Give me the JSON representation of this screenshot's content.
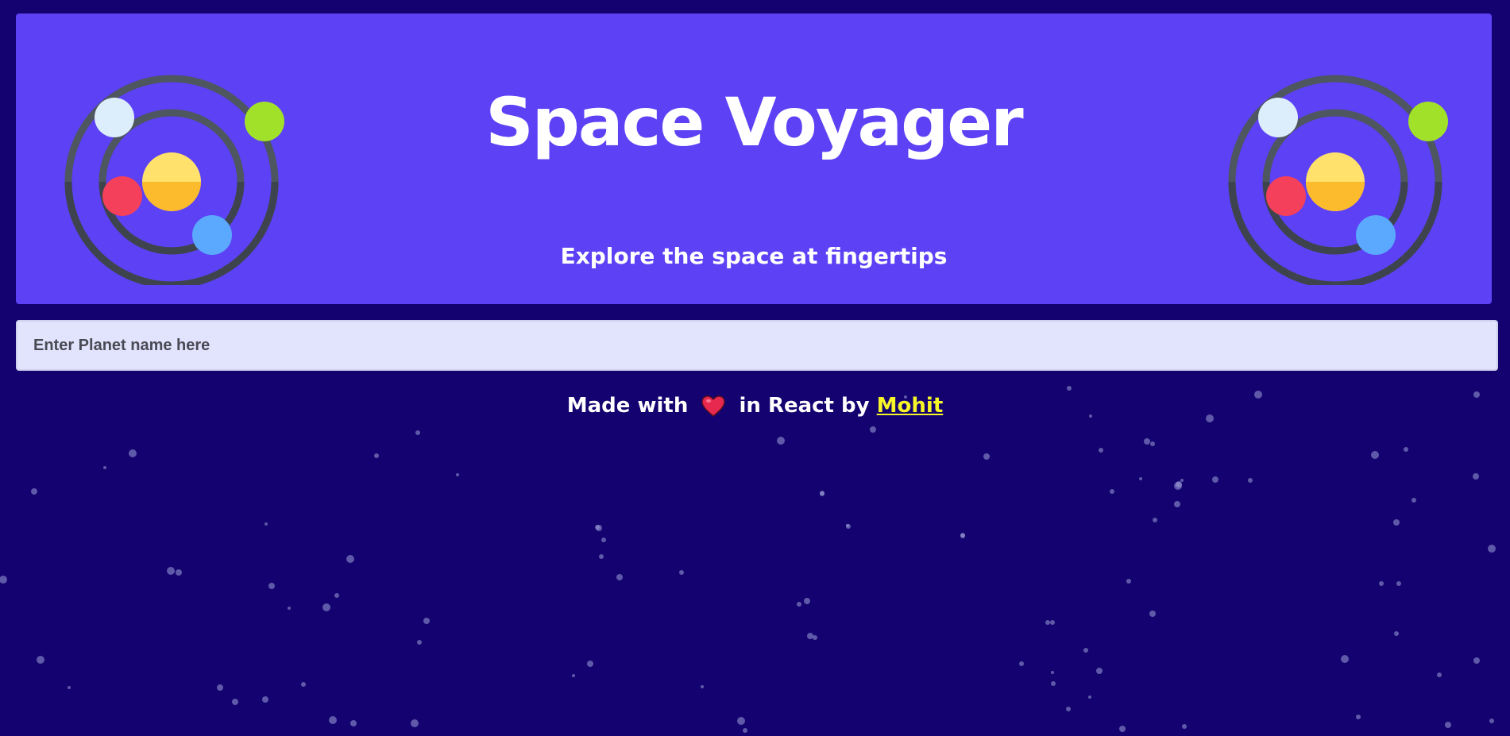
{
  "header": {
    "title": "Space Voyager",
    "subtitle": "Explore the space at fingertips",
    "logo_icon": "solar-system-icon"
  },
  "search": {
    "placeholder": "Enter Planet name here",
    "value": ""
  },
  "footer": {
    "prefix": "Made with",
    "heart_icon": "heart-icon",
    "middle": "in React by",
    "author": "Mohit"
  },
  "colors": {
    "background": "#13026f",
    "header_bg": "#5c41f5",
    "search_bg": "#e2e3fd",
    "author_link": "#f5f528",
    "planet_sun": "#ffd54f",
    "planet_white": "#dceefb",
    "planet_green": "#a2e12a",
    "planet_red": "#f4405a",
    "planet_blue": "#5aa9ff",
    "orbit": "#4e5660"
  }
}
